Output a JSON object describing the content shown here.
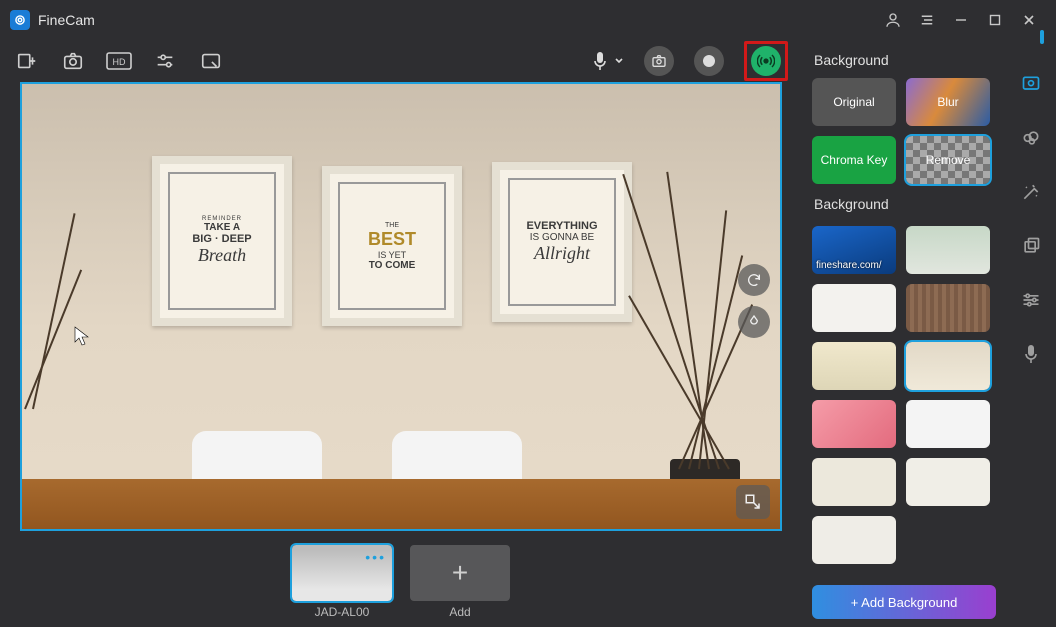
{
  "app": {
    "title": "FineCam"
  },
  "toolbar": {
    "stream_highlighted": true
  },
  "panel": {
    "modes_header": "Background",
    "list_header": "Background",
    "modes": {
      "original": "Original",
      "blur": "Blur",
      "chroma": "Chroma Key",
      "remove": "Remove"
    },
    "images": [
      {
        "caption": "fineshare.com/",
        "style": "linear-gradient(160deg,#1a66c9,#0a3b7d)"
      },
      {
        "caption": "",
        "style": "linear-gradient(180deg,#c7d8c7 0%,#e1e6de 100%)"
      },
      {
        "caption": "",
        "style": "#f3f2ee"
      },
      {
        "caption": "",
        "style": "repeating-linear-gradient(90deg,#7a5a45 0 4px,#8d6b53 4px 8px)"
      },
      {
        "caption": "",
        "style": "linear-gradient(180deg,#f0e8cc 0%,#ded6b7 100%)"
      },
      {
        "caption": "",
        "style": "linear-gradient(180deg,#e2d9c7 0%,#f0e9d9 100%)",
        "selected": true
      },
      {
        "caption": "",
        "style": "linear-gradient(135deg,#f59ca8,#e36b7e)"
      },
      {
        "caption": "",
        "style": "#f4f4f4"
      },
      {
        "caption": "",
        "style": "#ece8dc"
      },
      {
        "caption": "",
        "style": "#f0eee7"
      },
      {
        "caption": "",
        "style": "#efede7"
      },
      {
        "caption": "",
        "style": "#2e2e31"
      }
    ],
    "add_button": "+ Add Background"
  },
  "sources": {
    "items": [
      {
        "label": "JAD-AL00",
        "active": true,
        "cls": "roomthumb"
      },
      {
        "label": "Add",
        "add": true
      }
    ]
  },
  "preview": {
    "frames": {
      "f1": {
        "l1": "REMINDER",
        "l2": "TAKE A",
        "l3": "BIG · DEEP",
        "l4": "Breath"
      },
      "f2": {
        "l1": "THE",
        "l2": "BEST",
        "l3": "IS YET",
        "l4": "TO COME"
      },
      "f3": {
        "l1": "EVERYTHING",
        "l2": "IS GONNA BE",
        "l3": "Allright"
      }
    }
  }
}
